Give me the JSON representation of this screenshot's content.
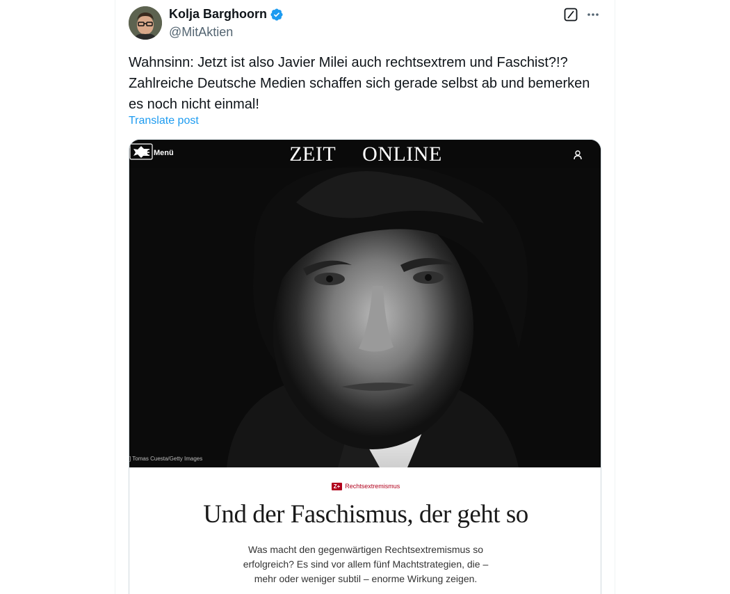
{
  "author": {
    "display_name": "Kolja Barghoorn",
    "handle": "@MitAktien",
    "verified": true
  },
  "icons": {
    "verified": "verified-badge-icon",
    "grok": "grok-icon",
    "more": "more-options-icon"
  },
  "post": {
    "text": "Wahnsinn: Jetzt ist also Javier Milei auch rechtsextrem und Faschist?!? Zahlreiche Deutsche Medien schaffen sich gerade selbst ab und bemerken es noch nicht einmal!",
    "translate_label": "Translate post"
  },
  "media": {
    "menu_label": "Menü",
    "logo_left": "ZEIT",
    "logo_right": "ONLINE",
    "photo_credit": "] Tomas Cuesta/Getty Images",
    "zplus_label": "Z+",
    "kicker": "Rechtsextremismus",
    "headline": "Und der Faschismus, der geht so",
    "teaser": "Was macht den gegenwärtigen Rechtsextremismus so erfolgreich? Es sind vor allem fünf Machtstrategien, die – mehr oder weniger subtil – enorme Wirkung zeigen."
  },
  "colors": {
    "link": "#1d9bf0",
    "verified": "#1d9bf0",
    "kicker": "#b1001c"
  }
}
